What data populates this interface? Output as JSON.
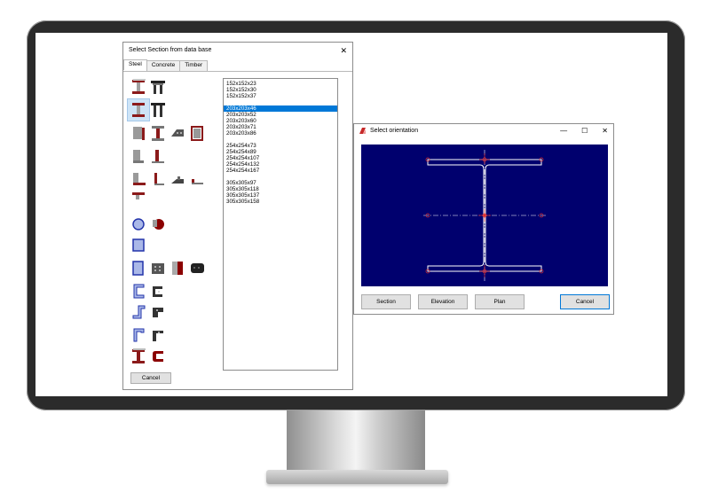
{
  "section_dialog": {
    "title": "Select Section from data base",
    "close_glyph": "✕",
    "tabs": [
      {
        "label": "Steel",
        "active": true
      },
      {
        "label": "Concrete",
        "active": false
      },
      {
        "label": "Timber",
        "active": false
      }
    ],
    "sections": [
      "152x152x23",
      "152x152x30",
      "152x152x37",
      "",
      "203x203x46",
      "203x203x52",
      "203x203x60",
      "203x203x71",
      "203x203x86",
      "",
      "254x254x73",
      "254x254x89",
      "254x254x107",
      "254x254x132",
      "254x254x167",
      "",
      "305x305x97",
      "305x305x118",
      "305x305x137",
      "305x305x158"
    ],
    "selected_section": "203x203x46",
    "cancel_label": "Cancel"
  },
  "orientation_dialog": {
    "title": "Select orientation",
    "min_glyph": "—",
    "max_glyph": "☐",
    "close_glyph": "✕",
    "buttons": {
      "section": "Section",
      "elevation": "Elevation",
      "plan": "Plan",
      "cancel": "Cancel"
    }
  },
  "colors": {
    "canvas_bg": "#00006e",
    "selection": "#0078d7",
    "marker": "#e03030",
    "profile_line": "#ffffff",
    "icon_red": "#8b0000"
  }
}
